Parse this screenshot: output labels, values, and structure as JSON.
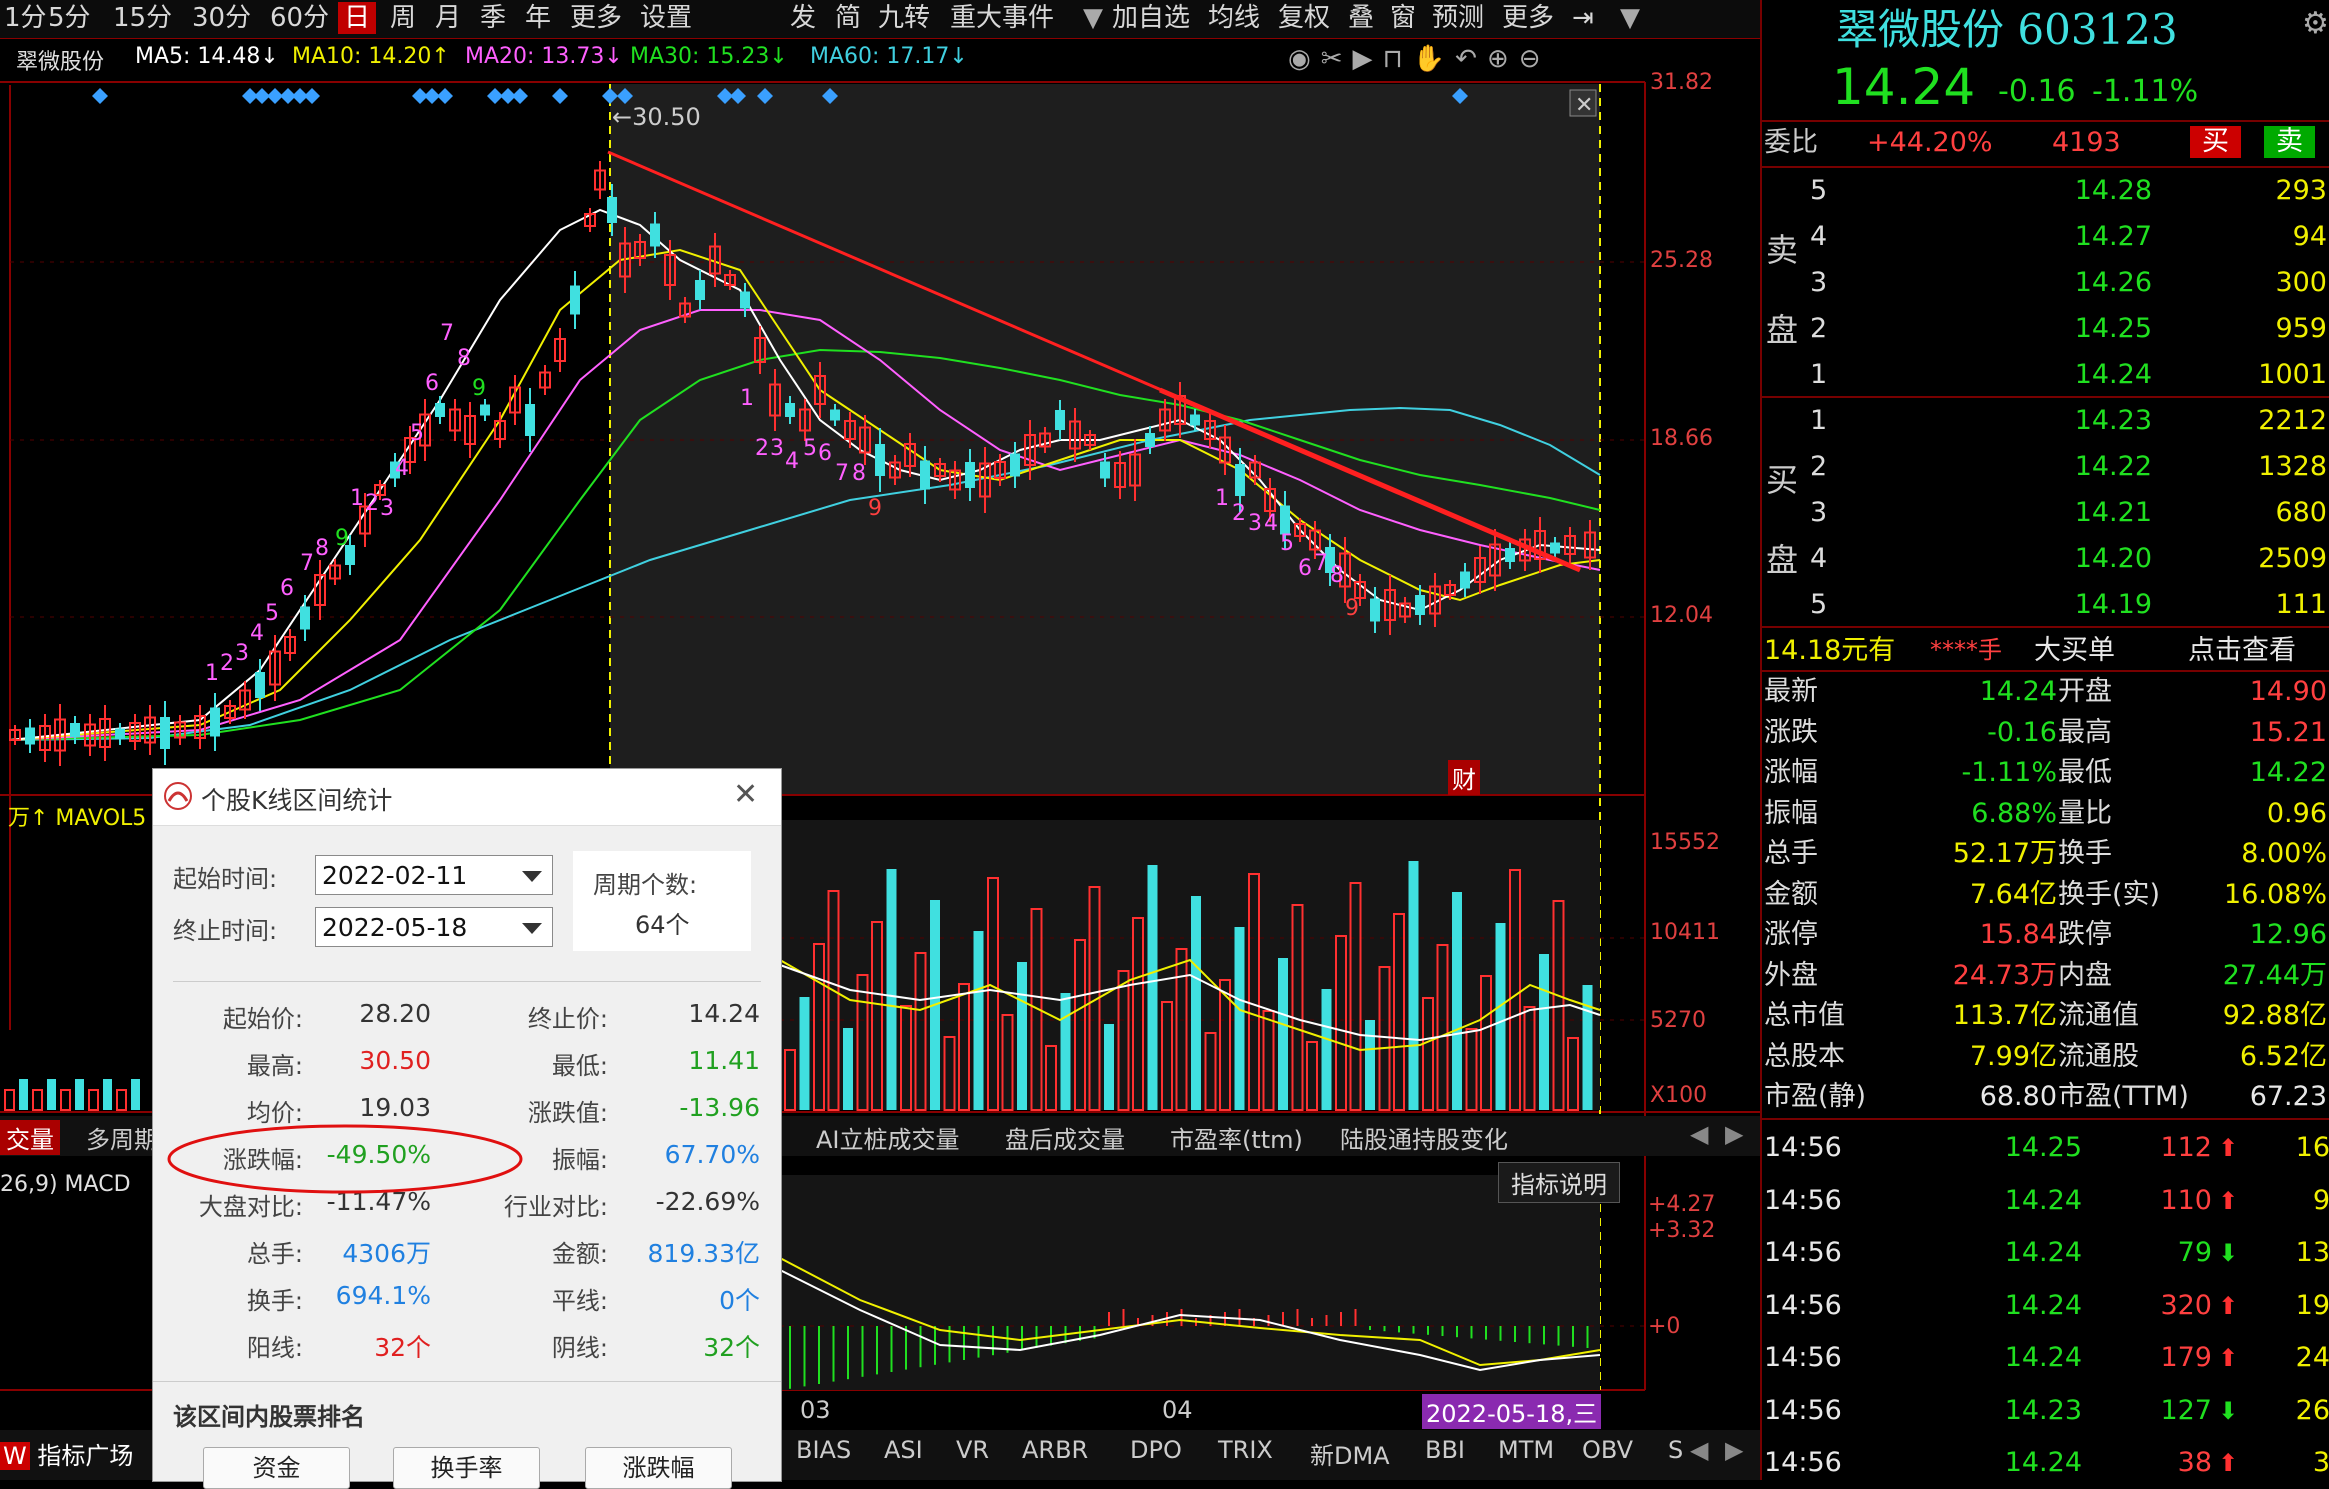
{
  "toolbar": {
    "items": [
      "1分",
      "5分",
      "15分",
      "30分",
      "60分",
      "日",
      "周",
      "月",
      "季",
      "年",
      "更多",
      "设置"
    ],
    "selected": "日",
    "items2": [
      "发",
      "简",
      "九转",
      "重大事件",
      "加自选",
      "均线",
      "复权",
      "叠",
      "窗",
      "预测",
      "更多"
    ]
  },
  "ma_legend": {
    "stock": "翠微股份",
    "ma5": "MA5: 14.48↓",
    "ma10": "MA10: 14.20↑",
    "ma20": "MA20: 13.73↓",
    "ma30": "MA30: 15.23↓",
    "ma60": "MA60: 17.17↓"
  },
  "price_axis": [
    "31.82",
    "25.28",
    "18.66",
    "12.04"
  ],
  "vol_axis": [
    "15552",
    "10411",
    "5270",
    "X100"
  ],
  "macd_axis": [
    "+4.27",
    "+3.32",
    "+0"
  ],
  "peak_label": "30.50",
  "price_chart_labels": {
    "caizhang": "财"
  },
  "vol_legend": "万↑ MAVOL5",
  "macd_legend": "26,9) MACD",
  "mid_tabs": [
    "交量",
    "多周期",
    "AI立桩成交量",
    "盘后成交量",
    "市盈率(ttm)",
    "陆股通持股变化"
  ],
  "indicator_btn": "指标说明",
  "x_labels": [
    "03",
    "04"
  ],
  "date_marker": "2022-05-18,三",
  "bottom_tabs": [
    "指标广场",
    "BIAS",
    "ASI",
    "VR",
    "ARBR",
    "DPO",
    "TRIX",
    "新DMA",
    "BBI",
    "MTM",
    "OBV",
    "S"
  ],
  "dialog": {
    "title": "个股K线区间统计",
    "start_label": "起始时间:",
    "start_value": "2022-02-11",
    "end_label": "终止时间:",
    "end_value": "2022-05-18",
    "period_label": "周期个数:",
    "period_value": "64个",
    "stats": [
      {
        "k1": "起始价:",
        "v1": "28.20",
        "k2": "终止价:",
        "v2": "14.24"
      },
      {
        "k1": "最高:",
        "v1": "30.50",
        "k2": "最低:",
        "v2": "11.41"
      },
      {
        "k1": "均价:",
        "v1": "19.03",
        "k2": "涨跌值:",
        "v2": "-13.96"
      },
      {
        "k1": "涨跌幅:",
        "v1": "-49.50%",
        "k2": "振幅:",
        "v2": "67.70%"
      },
      {
        "k1": "大盘对比:",
        "v1": "-11.47%",
        "k2": "行业对比:",
        "v2": "-22.69%"
      },
      {
        "k1": "总手:",
        "v1": "4306万",
        "k2": "金额:",
        "v2": "819.33亿"
      },
      {
        "k1": "换手:",
        "v1": "694.1%",
        "k2": "平线:",
        "v2": "0个"
      },
      {
        "k1": "阳线:",
        "v1": "32个",
        "k2": "阴线:",
        "v2": "32个"
      }
    ],
    "ranking_title": "该区间内股票排名",
    "buttons": [
      "资金",
      "换手率",
      "涨跌幅"
    ]
  },
  "quote": {
    "name": "翠微股份",
    "code": "603123",
    "price": "14.24",
    "change": "-0.16",
    "pct": "-1.11%",
    "weibi_label": "委比",
    "weibi": "+44.20%",
    "weicha": "4193",
    "buy_btn": "买",
    "sell_btn": "卖",
    "sell_side": "卖盘",
    "buy_side": "买盘",
    "asks": [
      {
        "lvl": "5",
        "price": "14.28",
        "vol": "293"
      },
      {
        "lvl": "4",
        "price": "14.27",
        "vol": "94"
      },
      {
        "lvl": "3",
        "price": "14.26",
        "vol": "300"
      },
      {
        "lvl": "2",
        "price": "14.25",
        "vol": "959"
      },
      {
        "lvl": "1",
        "price": "14.24",
        "vol": "1001"
      }
    ],
    "bids": [
      {
        "lvl": "1",
        "price": "14.23",
        "vol": "2212"
      },
      {
        "lvl": "2",
        "price": "14.22",
        "vol": "1328"
      },
      {
        "lvl": "3",
        "price": "14.21",
        "vol": "680"
      },
      {
        "lvl": "4",
        "price": "14.20",
        "vol": "2509"
      },
      {
        "lvl": "5",
        "price": "14.19",
        "vol": "111"
      }
    ],
    "bigbuy": {
      "price": "14.18元有",
      "stars": "****手",
      "text": "大买单",
      "link": "点击查看"
    },
    "stats": [
      {
        "k1": "最新",
        "v1": "14.24",
        "k2": "开盘",
        "v2": "14.90"
      },
      {
        "k1": "涨跌",
        "v1": "-0.16",
        "k2": "最高",
        "v2": "15.21"
      },
      {
        "k1": "涨幅",
        "v1": "-1.11%",
        "k2": "最低",
        "v2": "14.22"
      },
      {
        "k1": "振幅",
        "v1": "6.88%",
        "k2": "量比",
        "v2": "0.96"
      },
      {
        "k1": "总手",
        "v1": "52.17万",
        "k2": "换手",
        "v2": "8.00%"
      },
      {
        "k1": "金额",
        "v1": "7.64亿",
        "k2": "换手(实)",
        "v2": "16.08%"
      },
      {
        "k1": "涨停",
        "v1": "15.84",
        "k2": "跌停",
        "v2": "12.96"
      },
      {
        "k1": "外盘",
        "v1": "24.73万",
        "k2": "内盘",
        "v2": "27.44万"
      },
      {
        "k1": "总市值",
        "v1": "113.7亿",
        "k2": "流通值",
        "v2": "92.88亿"
      },
      {
        "k1": "总股本",
        "v1": "7.99亿",
        "k2": "流通股",
        "v2": "6.52亿"
      },
      {
        "k1": "市盈(静)",
        "v1": "68.80",
        "k2": "市盈(TTM)",
        "v2": "67.23"
      }
    ],
    "ticks": [
      {
        "t": "14:56",
        "p": "14.25",
        "v": "112",
        "dir": "up",
        "n": "16"
      },
      {
        "t": "14:56",
        "p": "14.24",
        "v": "110",
        "dir": "up",
        "n": "9"
      },
      {
        "t": "14:56",
        "p": "14.24",
        "v": "79",
        "dir": "down",
        "n": "13"
      },
      {
        "t": "14:56",
        "p": "14.24",
        "v": "320",
        "dir": "up",
        "n": "19"
      },
      {
        "t": "14:56",
        "p": "14.24",
        "v": "179",
        "dir": "up",
        "n": "24"
      },
      {
        "t": "14:56",
        "p": "14.23",
        "v": "127",
        "dir": "down",
        "n": "26"
      },
      {
        "t": "14:56",
        "p": "14.24",
        "v": "38",
        "dir": "up",
        "n": "3"
      }
    ]
  }
}
